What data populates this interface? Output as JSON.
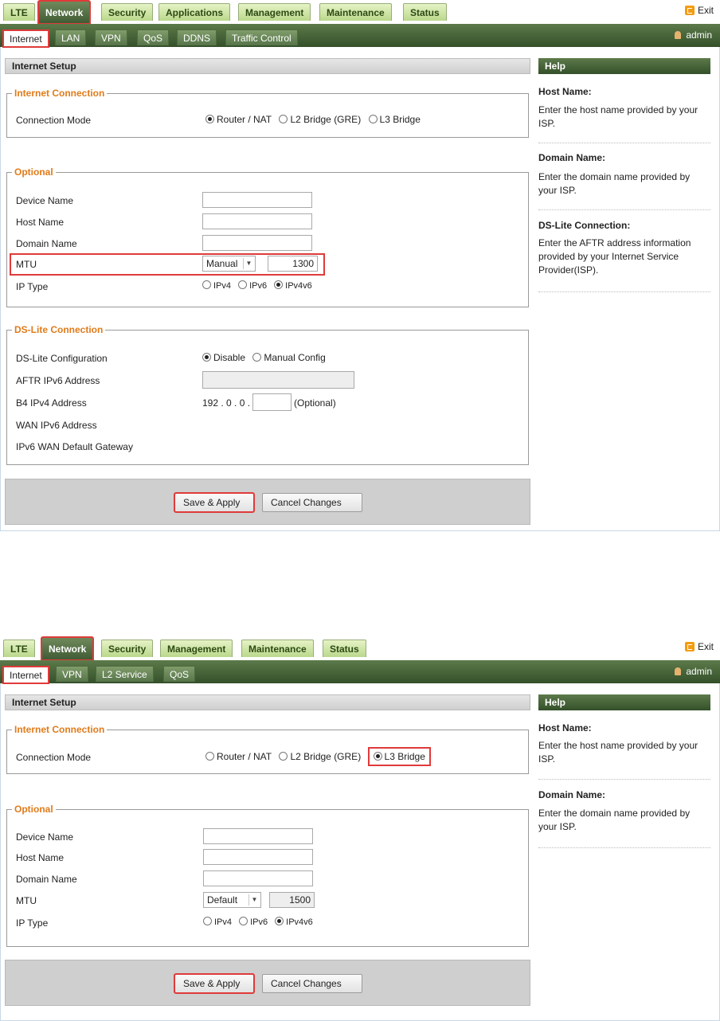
{
  "panel1": {
    "top_tabs": [
      "LTE",
      "Network",
      "Security",
      "Applications",
      "Management",
      "Maintenance",
      "Status"
    ],
    "exit_label": "Exit",
    "sub_tabs": [
      "Internet",
      "LAN",
      "VPN",
      "QoS",
      "DDNS",
      "Traffic Control"
    ],
    "user_label": "admin",
    "section_title": "Internet Setup",
    "help_title": "Help",
    "internet_connection": {
      "legend": "Internet Connection",
      "label": "Connection Mode",
      "options": [
        "Router / NAT",
        "L2 Bridge (GRE)",
        "L3 Bridge"
      ],
      "selected": "Router / NAT"
    },
    "optional": {
      "legend": "Optional",
      "device_name_label": "Device Name",
      "host_name_label": "Host Name",
      "domain_name_label": "Domain Name",
      "mtu_label": "MTU",
      "mtu_mode": "Manual",
      "mtu_value": "1300",
      "ip_type_label": "IP Type",
      "ip_type_options": [
        "IPv4",
        "IPv6",
        "IPv4v6"
      ],
      "ip_type_selected": "IPv4v6"
    },
    "dslite": {
      "legend": "DS-Lite Connection",
      "config_label": "DS-Lite Configuration",
      "config_options": [
        "Disable",
        "Manual Config"
      ],
      "config_selected": "Disable",
      "aftr_label": "AFTR IPv6 Address",
      "b4_label": "B4 IPv4 Address",
      "b4_prefix": "192 . 0 . 0 .",
      "b4_suffix": "(Optional)",
      "wan_ipv6_label": "WAN IPv6 Address",
      "gateway_label": "IPv6 WAN Default Gateway"
    },
    "save_label": "Save & Apply",
    "cancel_label": "Cancel Changes",
    "help": [
      {
        "title": "Host Name:",
        "text": "Enter the host name provided by your ISP."
      },
      {
        "title": "Domain Name:",
        "text": "Enter the domain name provided by your ISP."
      },
      {
        "title": "DS-Lite Connection:",
        "text": "Enter the AFTR address information provided by your Internet Service Provider(ISP)."
      }
    ]
  },
  "panel2": {
    "top_tabs": [
      "LTE",
      "Network",
      "Security",
      "Management",
      "Maintenance",
      "Status"
    ],
    "exit_label": "Exit",
    "sub_tabs": [
      "Internet",
      "VPN",
      "L2 Service",
      "QoS"
    ],
    "user_label": "admin",
    "section_title": "Internet Setup",
    "help_title": "Help",
    "internet_connection": {
      "legend": "Internet Connection",
      "label": "Connection Mode",
      "options": [
        "Router / NAT",
        "L2 Bridge (GRE)",
        "L3 Bridge"
      ],
      "selected": "L3 Bridge"
    },
    "optional": {
      "legend": "Optional",
      "device_name_label": "Device Name",
      "host_name_label": "Host Name",
      "domain_name_label": "Domain Name",
      "mtu_label": "MTU",
      "mtu_mode": "Default",
      "mtu_value": "1500",
      "ip_type_label": "IP Type",
      "ip_type_options": [
        "IPv4",
        "IPv6",
        "IPv4v6"
      ],
      "ip_type_selected": "IPv4v6"
    },
    "save_label": "Save & Apply",
    "cancel_label": "Cancel Changes",
    "help": [
      {
        "title": "Host Name:",
        "text": "Enter the host name provided by your ISP."
      },
      {
        "title": "Domain Name:",
        "text": "Enter the domain name provided by your ISP."
      }
    ]
  },
  "colors": {
    "highlight": "#e03a3a",
    "active_tab": "#3f5a33",
    "legend": "#e07b1a"
  }
}
